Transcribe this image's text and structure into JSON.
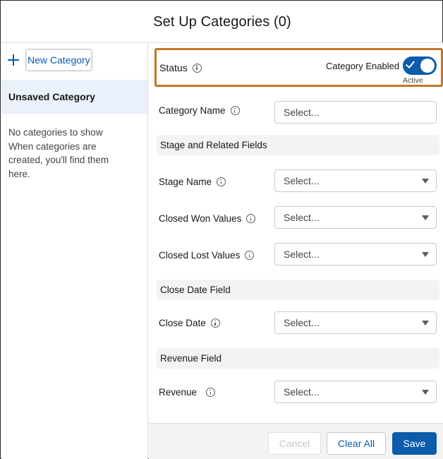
{
  "header": {
    "title": "Set Up Categories (0)"
  },
  "sidebar": {
    "new_category_label": "New Category",
    "unsaved_label": "Unsaved Category",
    "empty_line1": "No categories to show",
    "empty_line2": "When categories are created, you'll find them here."
  },
  "status": {
    "label": "Status",
    "enabled_label": "Category Enabled",
    "toggle_state": "Active",
    "toggle_on": true
  },
  "form": {
    "category_name": {
      "label": "Category Name",
      "placeholder": "Select..."
    },
    "stage_section": "Stage and Related Fields",
    "stage_name": {
      "label": "Stage Name",
      "placeholder": "Select..."
    },
    "closed_won": {
      "label": "Closed Won Values",
      "placeholder": "Select..."
    },
    "closed_lost": {
      "label": "Closed Lost Values",
      "placeholder": "Select..."
    },
    "close_date_section": "Close Date Field",
    "close_date": {
      "label": "Close Date",
      "placeholder": "Select..."
    },
    "revenue_section": "Revenue Field",
    "revenue": {
      "label": "Revenue",
      "placeholder": "Select..."
    }
  },
  "footer": {
    "cancel_label": "Cancel",
    "clear_label": "Clear All",
    "save_label": "Save"
  },
  "colors": {
    "brand_blue": "#0b5cab",
    "highlight_border": "#c2772a",
    "section_bg": "#f3f3f3",
    "selected_bg": "#eaf1fb"
  }
}
